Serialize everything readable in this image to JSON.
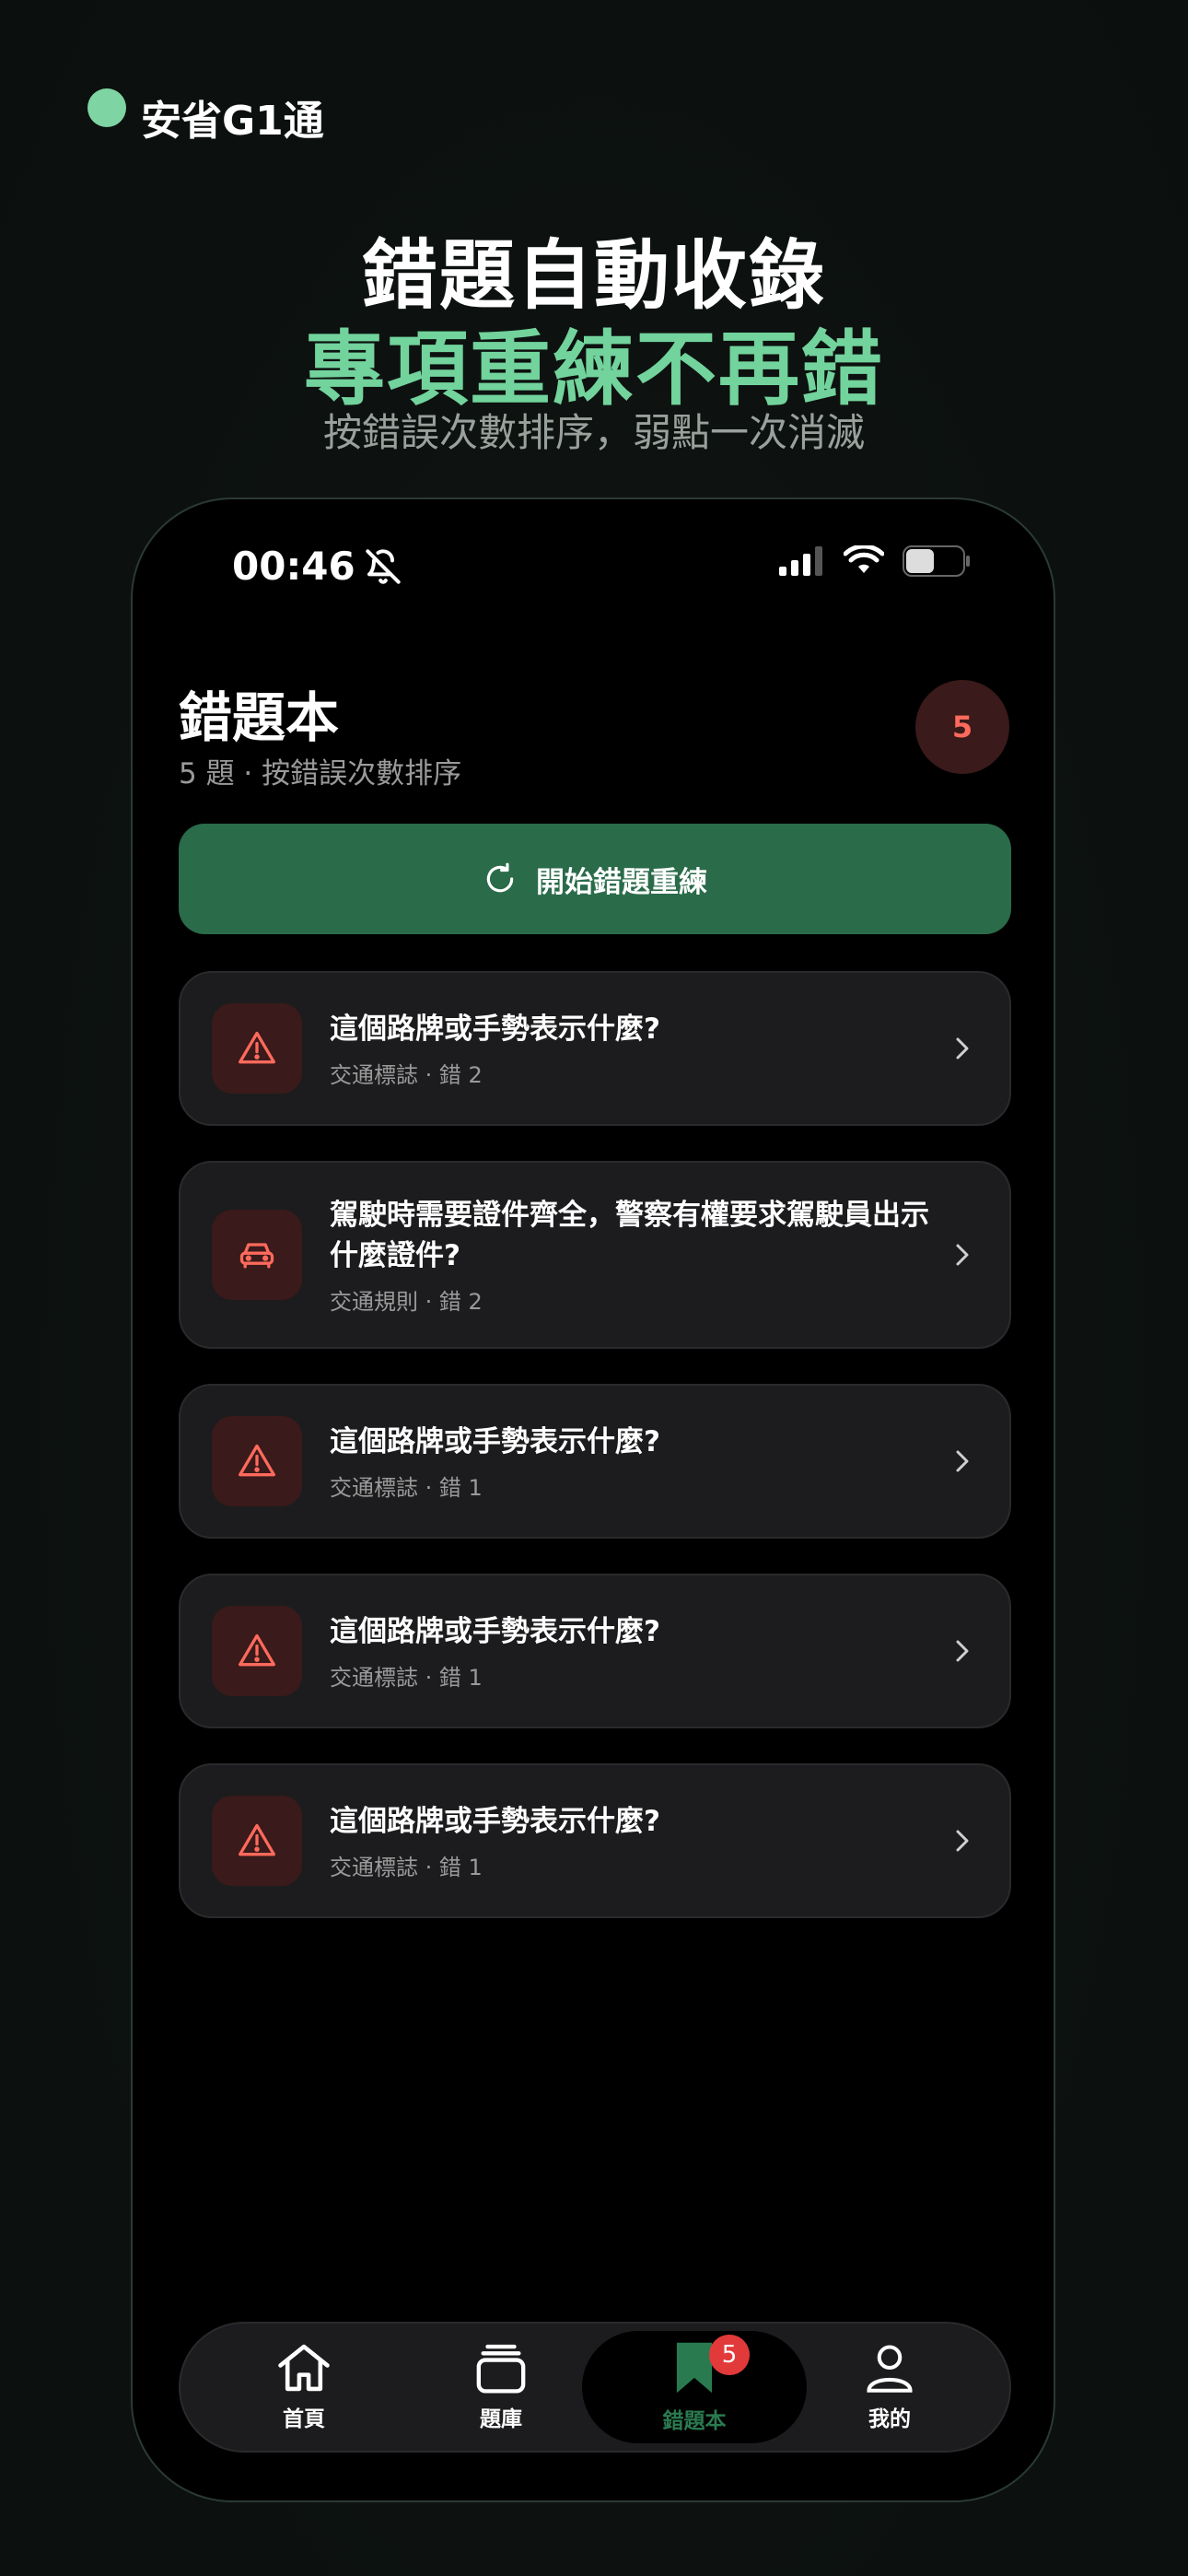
{
  "brand": {
    "name": "安省G1通",
    "dot_color": "#7fd4a4"
  },
  "hero": {
    "title": "錯題自動收錄",
    "accent": "專項重練不再錯",
    "subtitle": "按錯誤次數排序，弱點一次消滅"
  },
  "status_bar": {
    "time": "00:46"
  },
  "page": {
    "title": "錯題本",
    "subtitle": "5 題 · 按錯誤次數排序",
    "count_badge": "5",
    "start_button": "開始錯題重練"
  },
  "items": [
    {
      "title": "這個路牌或手勢表示什麼?",
      "meta": "交通標誌 · 錯 2",
      "icon": "warning-icon"
    },
    {
      "title": "駕駛時需要證件齊全，警察有權要求駕駛員出示什麼證件?",
      "meta": "交通規則 · 錯 2",
      "icon": "car-icon"
    },
    {
      "title": "這個路牌或手勢表示什麼?",
      "meta": "交通標誌 · 錯 1",
      "icon": "warning-icon"
    },
    {
      "title": "這個路牌或手勢表示什麼?",
      "meta": "交通標誌 · 錯 1",
      "icon": "warning-icon"
    },
    {
      "title": "這個路牌或手勢表示什麼?",
      "meta": "交通標誌 · 錯 1",
      "icon": "warning-icon"
    }
  ],
  "tabs": [
    {
      "label": "首頁",
      "icon": "home-icon"
    },
    {
      "label": "題庫",
      "icon": "cards-icon"
    },
    {
      "label": "錯題本",
      "icon": "bookmark-icon",
      "badge": "5",
      "active": true
    },
    {
      "label": "我的",
      "icon": "profile-icon"
    }
  ],
  "colors": {
    "accent": "#72d39c",
    "primary_button": "#2a6b4a",
    "danger": "#ff6a5c",
    "active_tab": "#2a7a50"
  }
}
